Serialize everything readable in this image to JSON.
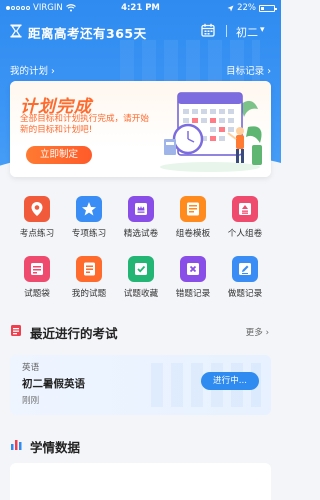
{
  "status_bar": {
    "carrier": "VIRGIN",
    "time": "4:21 PM",
    "battery": "22%"
  },
  "header": {
    "title": "距离高考还有365天",
    "grade": "初二",
    "my_plan": "我的计划",
    "goal_record": "目标记录"
  },
  "plan_card": {
    "title": "计划完成",
    "description": "全部目标和计划执行完成，请开始新的目标和计划吧!",
    "cta": "立即制定"
  },
  "tools": [
    {
      "label": "考点练习",
      "color": "#f15a3a",
      "icon": "location-pin-icon"
    },
    {
      "label": "专项练习",
      "color": "#3a8df5",
      "icon": "star-icon"
    },
    {
      "label": "精选试卷",
      "color": "#8a4ee8",
      "icon": "crown-paper-icon"
    },
    {
      "label": "组卷模板",
      "color": "#ff8a1e",
      "icon": "template-icon"
    },
    {
      "label": "个人组卷",
      "color": "#ef4b6e",
      "icon": "person-paper-icon"
    },
    {
      "label": "试题袋",
      "color": "#ef4b6e",
      "icon": "bag-icon"
    },
    {
      "label": "我的试题",
      "color": "#ff6a2d",
      "icon": "my-questions-icon"
    },
    {
      "label": "试题收藏",
      "color": "#22b573",
      "icon": "favorite-paper-icon"
    },
    {
      "label": "错题记录",
      "color": "#8a4ee8",
      "icon": "wrong-record-icon"
    },
    {
      "label": "做题记录",
      "color": "#3a8df5",
      "icon": "edit-record-icon"
    }
  ],
  "recent_exam": {
    "section_title": "最近进行的考试",
    "more": "更多",
    "subject": "英语",
    "exam_name": "初二暑假英语",
    "time": "刚刚",
    "progress_label": "进行中..."
  },
  "study_data": {
    "section_title": "学情数据"
  },
  "colors": {
    "brand_blue": "#2f8bf0",
    "accent_orange": "#ff6a2d"
  }
}
